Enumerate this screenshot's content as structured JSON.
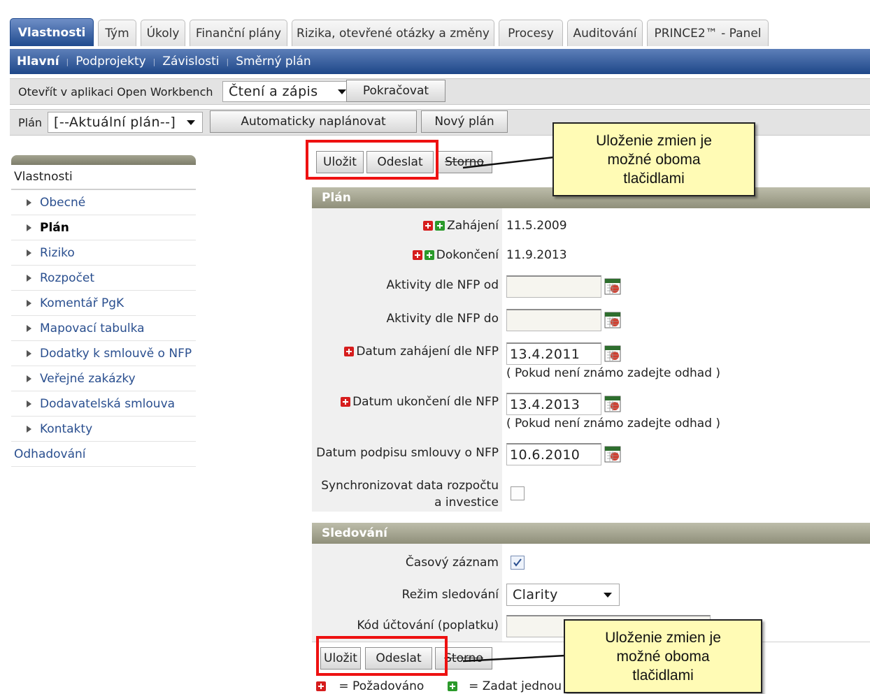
{
  "tabs": [
    "Vlastnosti",
    "Tým",
    "Úkoly",
    "Finanční plány",
    "Rizika, otevřené otázky a změny",
    "Procesy",
    "Auditování",
    "PRINCE2™ - Panel"
  ],
  "subnav": [
    "Hlavní",
    "Podprojekty",
    "Závislosti",
    "Směrný plán"
  ],
  "toolbar1": {
    "label": "Otevřít v aplikaci Open Workbench",
    "mode_value": "Čtení a zápis",
    "continue_button": "Pokračovat"
  },
  "toolbar2": {
    "label": "Plán",
    "plan_value": "[--Aktuální plán--]",
    "autoplan_button": "Automaticky naplánovat",
    "newplan_button": "Nový plán"
  },
  "actions": {
    "save": "Uložit",
    "submit": "Odeslat",
    "cancel": "Storno"
  },
  "leftnav": {
    "header": "Vlastnosti",
    "items": [
      "Obecné",
      "Plán",
      "Riziko",
      "Rozpočet",
      "Komentář PgK",
      "Mapovací tabulka",
      "Dodatky k smlouvě o NFP",
      "Veřejné zakázky",
      "Dodavatelská smlouva",
      "Kontakty"
    ],
    "current": "Plán",
    "footer": "Odhadování"
  },
  "plan_section": {
    "title": "Plán",
    "start_label": "Zahájení",
    "start_value": "11.5.2009",
    "finish_label": "Dokončení",
    "finish_value": "11.9.2013",
    "activities_from_label": "Aktivity dle NFP od",
    "activities_from_value": "",
    "activities_to_label": "Aktivity dle NFP do",
    "activities_to_value": "",
    "nfp_start_label": "Datum zahájení dle NFP",
    "nfp_start_value": "13.4.2011",
    "nfp_start_hint": "( Pokud není známo zadejte odhad )",
    "nfp_end_label": "Datum ukončení dle NFP",
    "nfp_end_value": "13.4.2013",
    "nfp_end_hint": "( Pokud není známo zadejte odhad )",
    "contract_sign_label": "Datum podpisu smlouvy o NFP",
    "contract_sign_value": "10.6.2010",
    "sync_label_1": "Synchronizovat data rozpočtu",
    "sync_label_2": "a investice",
    "sync_checked": false
  },
  "tracking_section": {
    "title": "Sledování",
    "timesheet_label": "Časový záznam",
    "timesheet_checked": true,
    "mode_label": "Režim sledování",
    "mode_value": "Clarity",
    "charge_code_label": "Kód účtování (poplatku)",
    "charge_code_value": ""
  },
  "legend": {
    "required": "= Požadováno",
    "enter_one": "= Zadat jednou"
  },
  "callout": {
    "line1": "Uloženie zmien je",
    "line2": "možné oboma",
    "line3": "tlačidlami"
  },
  "colors": {
    "tab_active": "#2a5294",
    "subnav": "#2f5797",
    "section": "#a5a592",
    "highlight": "#ee1111",
    "callout": "#fffbb5"
  }
}
